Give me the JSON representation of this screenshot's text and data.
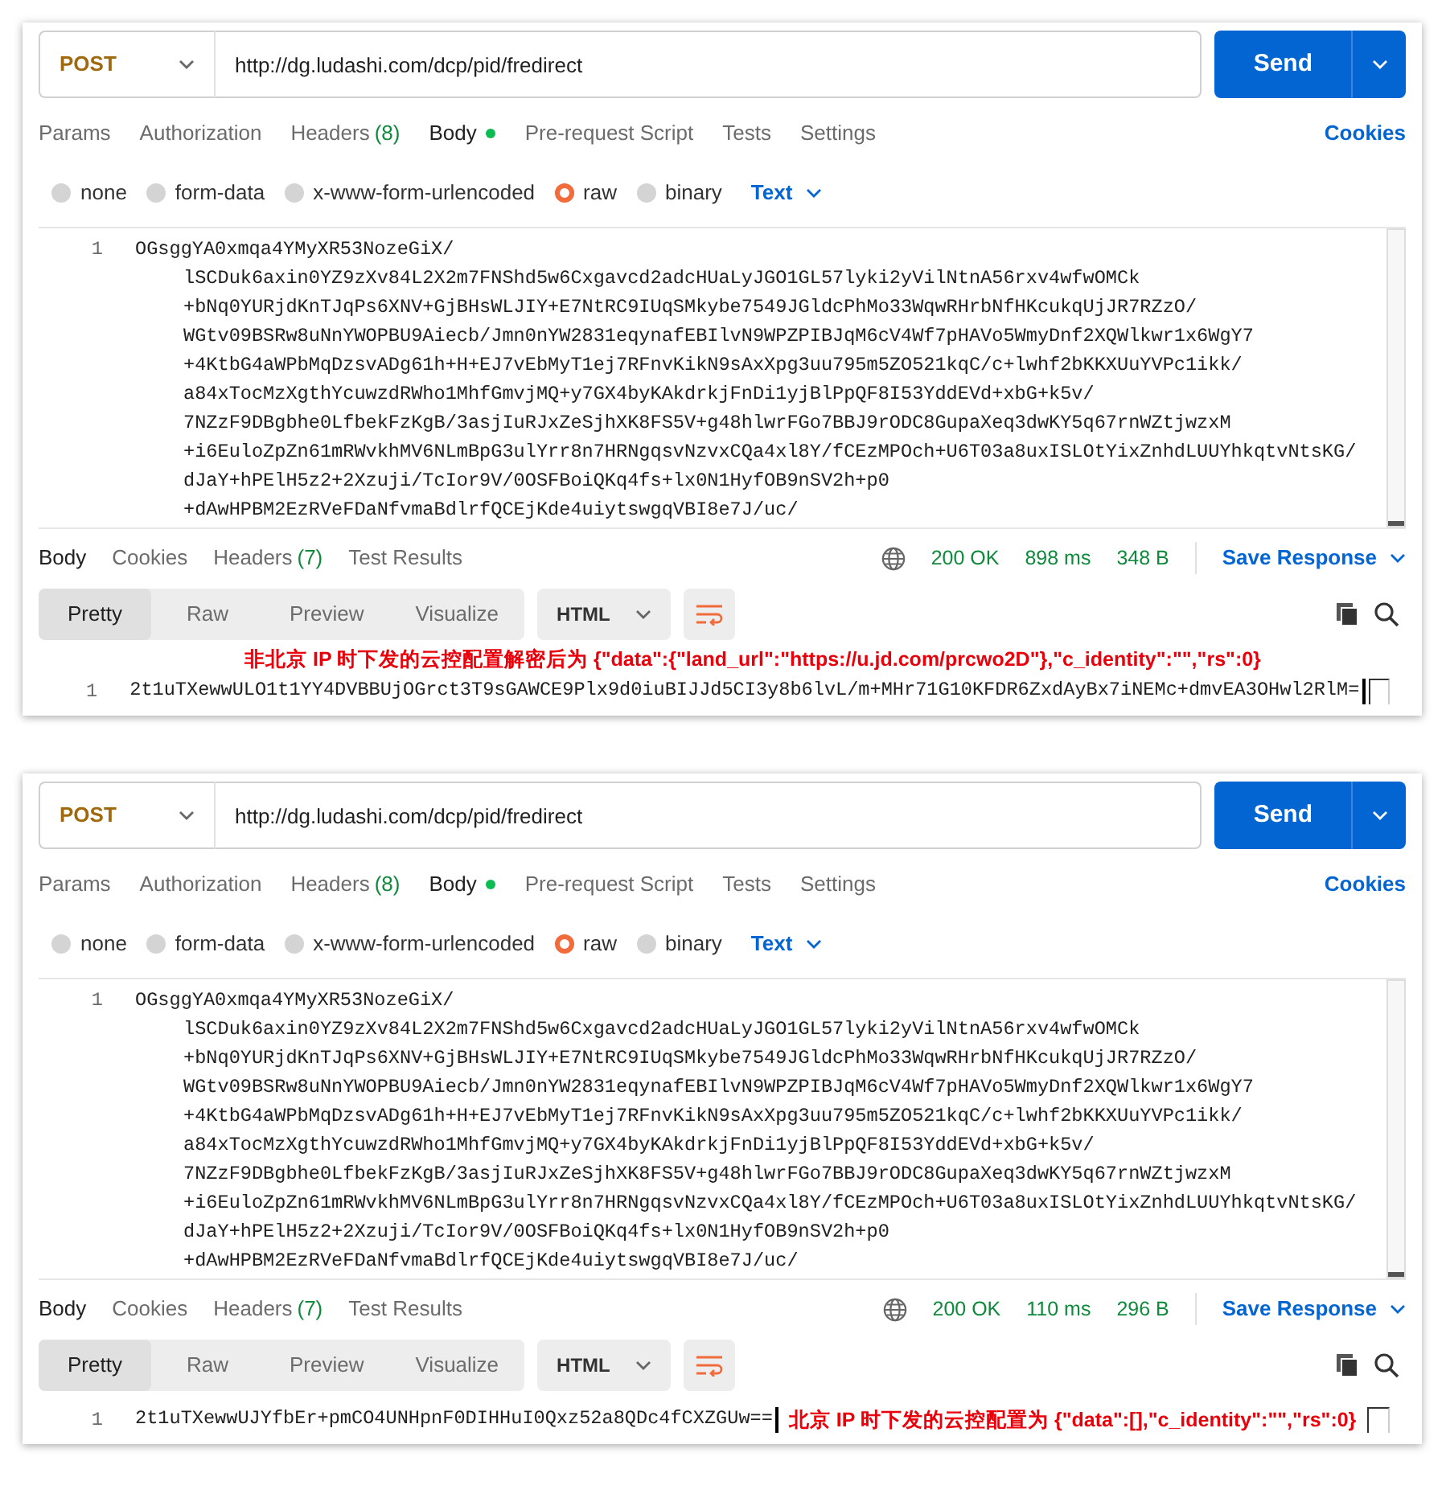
{
  "panels": [
    {
      "request": {
        "method": "POST",
        "url": "http://dg.ludashi.com/dcp/pid/fredirect",
        "send": "Send"
      },
      "request_tabs": [
        {
          "label": "Params",
          "selected": false,
          "dot": false
        },
        {
          "label": "Authorization",
          "selected": false,
          "dot": false
        },
        {
          "label": "Headers",
          "count": "(8)",
          "selected": false,
          "dot": false
        },
        {
          "label": "Body",
          "selected": true,
          "dot": true
        },
        {
          "label": "Pre-request Script",
          "selected": false,
          "dot": false
        },
        {
          "label": "Tests",
          "selected": false,
          "dot": false
        },
        {
          "label": "Settings",
          "selected": false,
          "dot": false
        }
      ],
      "cookies": "Cookies",
      "body_types": [
        {
          "label": "none",
          "selected": false
        },
        {
          "label": "form-data",
          "selected": false
        },
        {
          "label": "x-www-form-urlencoded",
          "selected": false
        },
        {
          "label": "raw",
          "selected": true
        },
        {
          "label": "binary",
          "selected": false
        }
      ],
      "body_format": "Text",
      "body": {
        "line_number": "1",
        "lines": [
          "OGsggYA0xmqa4YMyXR53NozeGiX/",
          "lSCDuk6axin0YZ9zXv84L2X2m7FNShd5w6Cxgavcd2adcHUaLyJGO1GL57lyki2yVilNtnA56rxv4wfwOMCk",
          "+bNq0YURjdKnTJqPs6XNV+GjBHsWLJIY+E7NtRC9IUqSMkybe7549JGldcPhMo33WqwRHrbNfHKcukqUjJR7RZzO/",
          "WGtv09BSRw8uNnYWOPBU9Aiecb/Jmn0nYW2831eqynafEBIlvN9WPZPIBJqM6cV4Wf7pHAVo5WmyDnf2XQWlkwr1x6WgY7",
          "+4KtbG4aWPbMqDzsvADg61h+H+EJ7vEbMyT1ej7RFnvKikN9sAxXpg3uu795m5ZO521kqC/c+lwhf2bKKXUuYVPc1ikk/",
          "a84xTocMzXgthYcuwzdRWho1MhfGmvjMQ+y7GX4byKAkdrkjFnDi1yjBlPpQF8I53YddEVd+xbG+k5v/",
          "7NZzF9DBgbhe0LfbekFzKgB/3asjIuRJxZeSjhXK8FS5V+g48hlwrFGo7BBJ9rODC8GupaXeq3dwKY5q67rnWZtjwzxM",
          "+i6EuloZpZn61mRWvkhMV6NLmBpG3ulYrr8n7HRNgqsvNzvxCQa4xl8Y/fCEzMPOch+U6T03a8uxISLOtYixZnhdLUUYhkqtvNtsKG/",
          "dJaY+hPElH5z2+2Xzuji/TcIor9V/0OSFBoiQKq4fs+lx0N1HyfOB9nSV2h+p0",
          "+dAwHPBM2EzRVeFDaNfvmaBdlrfQCEjKde4uiytswgqVBI8e7J/uc/"
        ]
      },
      "response_tabs": [
        {
          "label": "Body",
          "selected": true
        },
        {
          "label": "Cookies",
          "selected": false
        },
        {
          "label": "Headers",
          "count": "(7)",
          "selected": false
        },
        {
          "label": "Test Results",
          "selected": false
        }
      ],
      "status": "200 OK",
      "time": "898 ms",
      "size": "348 B",
      "save_response": "Save Response",
      "views": [
        {
          "label": "Pretty",
          "selected": true
        },
        {
          "label": "Raw",
          "selected": false
        },
        {
          "label": "Preview",
          "selected": false
        },
        {
          "label": "Visualize",
          "selected": false
        }
      ],
      "view_format": "HTML",
      "response": {
        "line_number": "1",
        "text": "2t1uTXewwULO1t1YY4DVBBUjOGrct3T9sGAWCE9Plx9d0iuBIJJd5CI3y8b6lvL/m+MHr71G10KFDR6ZxdAyBx7iNEMc+dmvEA3OHwl2RlM="
      },
      "annotation": {
        "text": "非北京 IP 时下发的云控配置解密后为 {\"data\":{\"land_url\":\"https://u.jd.com/prcwo2D\"},\"c_identity\":\"\",\"rs\":0}",
        "kind": "above"
      }
    },
    {
      "request": {
        "method": "POST",
        "url": "http://dg.ludashi.com/dcp/pid/fredirect",
        "send": "Send"
      },
      "request_tabs": [
        {
          "label": "Params",
          "selected": false,
          "dot": false
        },
        {
          "label": "Authorization",
          "selected": false,
          "dot": false
        },
        {
          "label": "Headers",
          "count": "(8)",
          "selected": false,
          "dot": false
        },
        {
          "label": "Body",
          "selected": true,
          "dot": true
        },
        {
          "label": "Pre-request Script",
          "selected": false,
          "dot": false
        },
        {
          "label": "Tests",
          "selected": false,
          "dot": false
        },
        {
          "label": "Settings",
          "selected": false,
          "dot": false
        }
      ],
      "cookies": "Cookies",
      "body_types": [
        {
          "label": "none",
          "selected": false
        },
        {
          "label": "form-data",
          "selected": false
        },
        {
          "label": "x-www-form-urlencoded",
          "selected": false
        },
        {
          "label": "raw",
          "selected": true
        },
        {
          "label": "binary",
          "selected": false
        }
      ],
      "body_format": "Text",
      "body": {
        "line_number": "1",
        "lines": [
          "OGsggYA0xmqa4YMyXR53NozeGiX/",
          "lSCDuk6axin0YZ9zXv84L2X2m7FNShd5w6Cxgavcd2adcHUaLyJGO1GL57lyki2yVilNtnA56rxv4wfwOMCk",
          "+bNq0YURjdKnTJqPs6XNV+GjBHsWLJIY+E7NtRC9IUqSMkybe7549JGldcPhMo33WqwRHrbNfHKcukqUjJR7RZzO/",
          "WGtv09BSRw8uNnYWOPBU9Aiecb/Jmn0nYW2831eqynafEBIlvN9WPZPIBJqM6cV4Wf7pHAVo5WmyDnf2XQWlkwr1x6WgY7",
          "+4KtbG4aWPbMqDzsvADg61h+H+EJ7vEbMyT1ej7RFnvKikN9sAxXpg3uu795m5ZO521kqC/c+lwhf2bKKXUuYVPc1ikk/",
          "a84xTocMzXgthYcuwzdRWho1MhfGmvjMQ+y7GX4byKAkdrkjFnDi1yjBlPpQF8I53YddEVd+xbG+k5v/",
          "7NZzF9DBgbhe0LfbekFzKgB/3asjIuRJxZeSjhXK8FS5V+g48hlwrFGo7BBJ9rODC8GupaXeq3dwKY5q67rnWZtjwzxM",
          "+i6EuloZpZn61mRWvkhMV6NLmBpG3ulYrr8n7HRNgqsvNzvxCQa4xl8Y/fCEzMPOch+U6T03a8uxISLOtYixZnhdLUUYhkqtvNtsKG/",
          "dJaY+hPElH5z2+2Xzuji/TcIor9V/0OSFBoiQKq4fs+lx0N1HyfOB9nSV2h+p0",
          "+dAwHPBM2EzRVeFDaNfvmaBdlrfQCEjKde4uiytswgqVBI8e7J/uc/"
        ]
      },
      "response_tabs": [
        {
          "label": "Body",
          "selected": true
        },
        {
          "label": "Cookies",
          "selected": false
        },
        {
          "label": "Headers",
          "count": "(7)",
          "selected": false
        },
        {
          "label": "Test Results",
          "selected": false
        }
      ],
      "status": "200 OK",
      "time": "110 ms",
      "size": "296 B",
      "save_response": "Save Response",
      "views": [
        {
          "label": "Pretty",
          "selected": true
        },
        {
          "label": "Raw",
          "selected": false
        },
        {
          "label": "Preview",
          "selected": false
        },
        {
          "label": "Visualize",
          "selected": false
        }
      ],
      "view_format": "HTML",
      "response": {
        "line_number": "1",
        "text": "2t1uTXewwUJYfbEr+pmCO4UNHpnF0DIHHuI0Qxz52a8QDc4fCXZGUw=="
      },
      "annotation": {
        "text": "北京 IP 时下发的云控配置为 {\"data\":[],\"c_identity\":\"\",\"rs\":0}",
        "kind": "inline"
      }
    }
  ]
}
